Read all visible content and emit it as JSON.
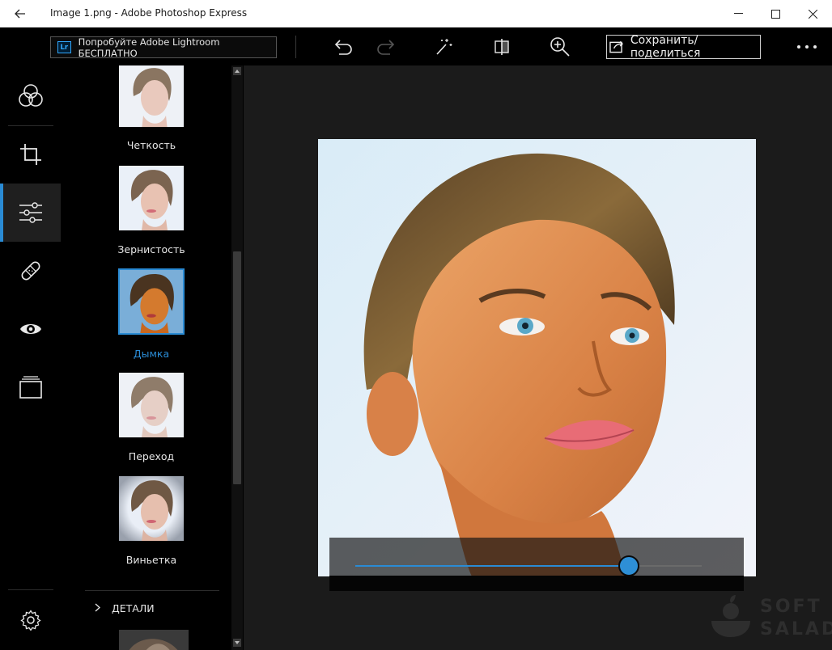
{
  "window": {
    "title": "Image 1.png - Adobe Photoshop Express",
    "controls": [
      "minimize-icon",
      "maximize-icon",
      "close-icon"
    ]
  },
  "toolbar": {
    "lightroom_badge": "Lr",
    "lightroom_label": "Попробуйте Adobe Lightroom БЕСПЛАТНО",
    "icons": [
      "undo-icon",
      "redo-icon",
      "auto-fix-icon",
      "compare-icon",
      "zoom-icon",
      "more-icon"
    ],
    "save_label": "Сохранить/поделиться"
  },
  "rail": {
    "items": [
      {
        "icon": "looks-icon",
        "active": false
      },
      {
        "icon": "crop-icon",
        "active": false
      },
      {
        "icon": "adjustments-icon",
        "active": true
      },
      {
        "icon": "healing-icon",
        "active": false
      },
      {
        "icon": "eye-icon",
        "active": false
      },
      {
        "icon": "borders-icon",
        "active": false
      }
    ],
    "settings_icon": "gear-icon"
  },
  "panel": {
    "items": [
      {
        "label": "Четкость",
        "selected": false
      },
      {
        "label": "Зернистость",
        "selected": false
      },
      {
        "label": "Дымка",
        "selected": true
      },
      {
        "label": "Переход",
        "selected": false
      },
      {
        "label": "Виньетка",
        "selected": false
      }
    ],
    "details_label": "ДЕТАЛИ"
  },
  "editor": {
    "slider_value": 0.79
  },
  "colors": {
    "accent": "#2a8bd4",
    "background": "#000000",
    "canvas": "#1b1b1b"
  },
  "watermark": {
    "line1": "SOFT",
    "line2": "SALAD"
  }
}
